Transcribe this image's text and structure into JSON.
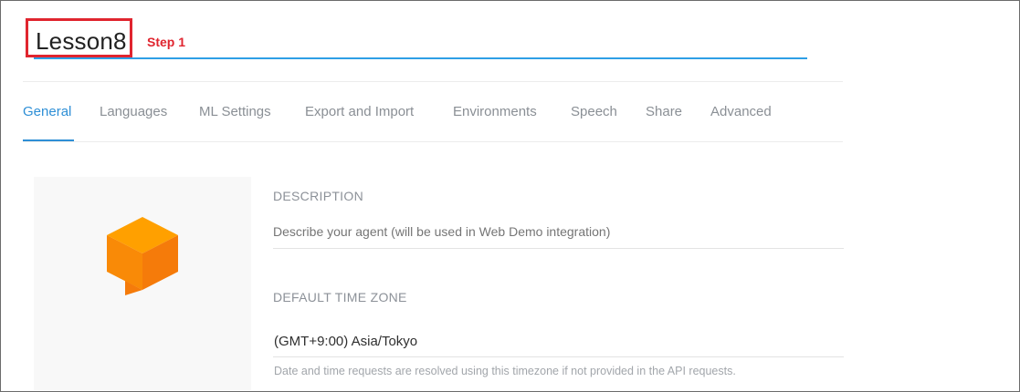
{
  "agent": {
    "name": "Lesson8",
    "annotation_step": "Step 1"
  },
  "tabs": [
    {
      "label": "General",
      "active": true
    },
    {
      "label": "Languages"
    },
    {
      "label": "ML Settings"
    },
    {
      "label": "Export and Import"
    },
    {
      "label": "Environments"
    },
    {
      "label": "Speech"
    },
    {
      "label": "Share"
    },
    {
      "label": "Advanced"
    }
  ],
  "avatar": {
    "icon": "speech-bubble-cube-icon"
  },
  "description": {
    "label": "DESCRIPTION",
    "placeholder": "Describe your agent (will be used in Web Demo integration)",
    "value": ""
  },
  "timezone": {
    "label": "DEFAULT TIME ZONE",
    "value": "(GMT+9:00) Asia/Tokyo",
    "hint": "Date and time requests are resolved using this timezone if not provided in the API requests."
  },
  "colors": {
    "accent": "#2e8fd6",
    "annotation": "#e0252f",
    "logo_light": "#ffa000",
    "logo_mid": "#f98a07",
    "logo_dark": "#f57b0a"
  }
}
